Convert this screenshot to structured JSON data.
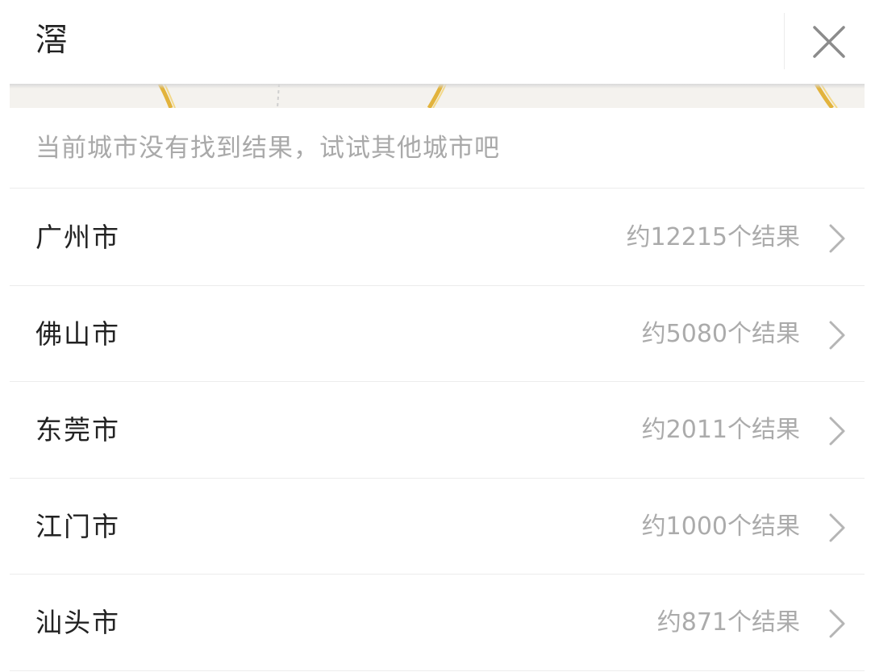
{
  "search": {
    "query": "滘",
    "close_icon": "close-icon"
  },
  "notice": {
    "text": "当前城市没有找到结果，试试其他城市吧"
  },
  "cities": [
    {
      "name": "广州市",
      "count": "约12215个结果",
      "icon": "chevron-right-icon"
    },
    {
      "name": "佛山市",
      "count": "约5080个结果",
      "icon": "chevron-right-icon"
    },
    {
      "name": "东莞市",
      "count": "约2011个结果",
      "icon": "chevron-right-icon"
    },
    {
      "name": "江门市",
      "count": "约1000个结果",
      "icon": "chevron-right-icon"
    },
    {
      "name": "汕头市",
      "count": "约871个结果",
      "icon": "chevron-right-icon"
    }
  ],
  "colors": {
    "primary_text": "#222222",
    "secondary_text": "#ababab",
    "divider": "#ececec",
    "map_road": "#e2b33c"
  }
}
